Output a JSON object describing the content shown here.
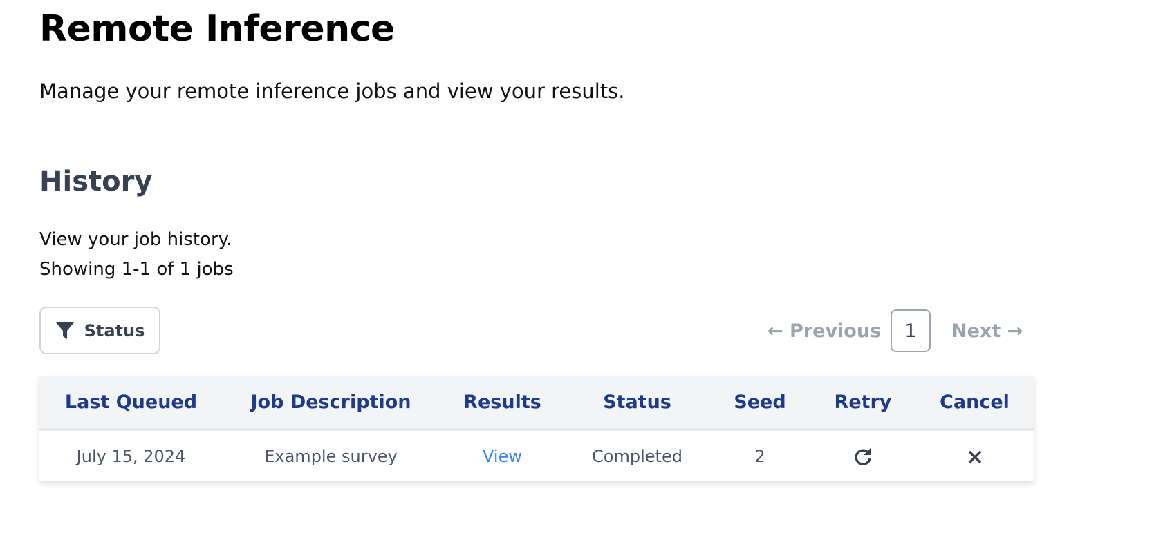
{
  "page": {
    "title": "Remote Inference",
    "subtitle": "Manage your remote inference jobs and view your results."
  },
  "history": {
    "title": "History",
    "description": "View your job history.",
    "showing": "Showing 1-1 of 1 jobs"
  },
  "filter": {
    "label": "Status",
    "icon": "filter-icon"
  },
  "pagination": {
    "previous": "← Previous",
    "current": "1",
    "next": "Next →"
  },
  "table": {
    "headers": [
      "Last Queued",
      "Job Description",
      "Results",
      "Status",
      "Seed",
      "Retry",
      "Cancel"
    ],
    "rows": [
      {
        "last_queued": "July 15, 2024",
        "description": "Example survey",
        "results": "View",
        "status": "Completed",
        "seed": "2",
        "retry_icon": "retry-icon",
        "cancel_icon": "close-icon"
      }
    ]
  },
  "colors": {
    "header_text": "#1e3a8a",
    "link": "#3b82f6",
    "header_bg": "#f3f4f6"
  }
}
